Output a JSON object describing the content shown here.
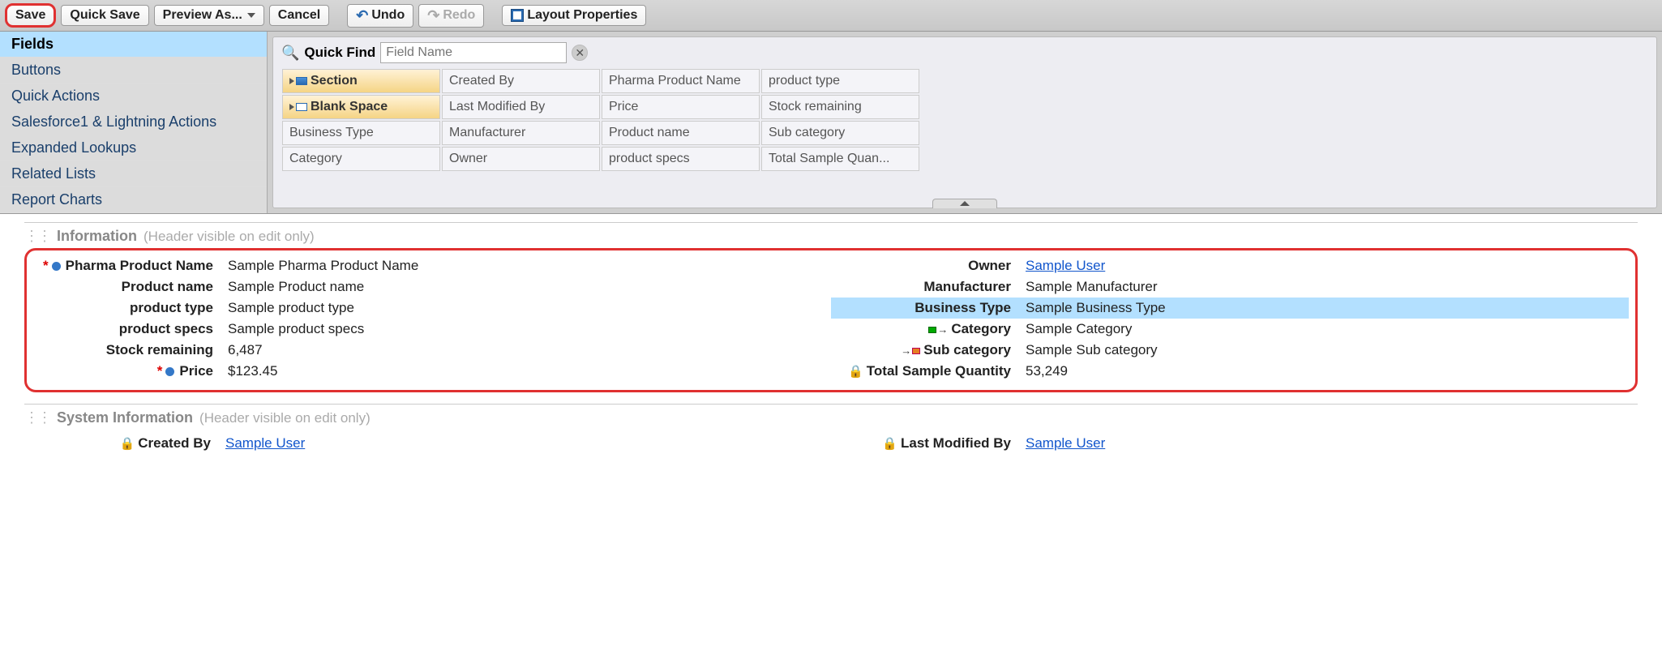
{
  "toolbar": {
    "save": "Save",
    "quick_save": "Quick Save",
    "preview_as": "Preview As...",
    "cancel": "Cancel",
    "undo": "Undo",
    "redo": "Redo",
    "layout_properties": "Layout Properties"
  },
  "sidebar": {
    "items": [
      "Fields",
      "Buttons",
      "Quick Actions",
      "Salesforce1 & Lightning Actions",
      "Expanded Lookups",
      "Related Lists",
      "Report Charts"
    ],
    "active_index": 0
  },
  "quickfind": {
    "label": "Quick Find",
    "placeholder": "Field Name"
  },
  "palette": {
    "col0": [
      "Section",
      "Blank Space",
      "Business Type",
      "Category"
    ],
    "col1": [
      "Created By",
      "Last Modified By",
      "Manufacturer",
      "Owner"
    ],
    "col2": [
      "Pharma Product Name",
      "Price",
      "Product name",
      "product specs"
    ],
    "col3": [
      "product type",
      "Stock remaining",
      "Sub category",
      "Total Sample Quan..."
    ]
  },
  "sections": {
    "information": {
      "title": "Information",
      "hint": "(Header visible on edit only)",
      "left": [
        {
          "label": "Pharma Product Name",
          "value": "Sample Pharma Product Name",
          "required": true,
          "dot": true
        },
        {
          "label": "Product name",
          "value": "Sample Product name"
        },
        {
          "label": "product type",
          "value": "Sample product type"
        },
        {
          "label": "product specs",
          "value": "Sample product specs"
        },
        {
          "label": "Stock remaining",
          "value": "6,487"
        },
        {
          "label": "Price",
          "value": "$123.45",
          "required": true,
          "dot": true
        }
      ],
      "right": [
        {
          "label": "Owner",
          "value": "Sample User",
          "link": true
        },
        {
          "label": "Manufacturer",
          "value": "Sample Manufacturer"
        },
        {
          "label": "Business Type",
          "value": "Sample Business Type",
          "highlighted": true
        },
        {
          "label": "Category",
          "value": "Sample Category",
          "dep": "green"
        },
        {
          "label": "Sub category",
          "value": "Sample Sub category",
          "dep": "orange"
        },
        {
          "label": "Total Sample Quantity",
          "value": "53,249",
          "lock": true
        }
      ]
    },
    "system": {
      "title": "System Information",
      "hint": "(Header visible on edit only)",
      "left": [
        {
          "label": "Created By",
          "value": "Sample User",
          "link": true,
          "lock": true
        }
      ],
      "right": [
        {
          "label": "Last Modified By",
          "value": "Sample User",
          "link": true,
          "lock": true
        }
      ]
    }
  }
}
